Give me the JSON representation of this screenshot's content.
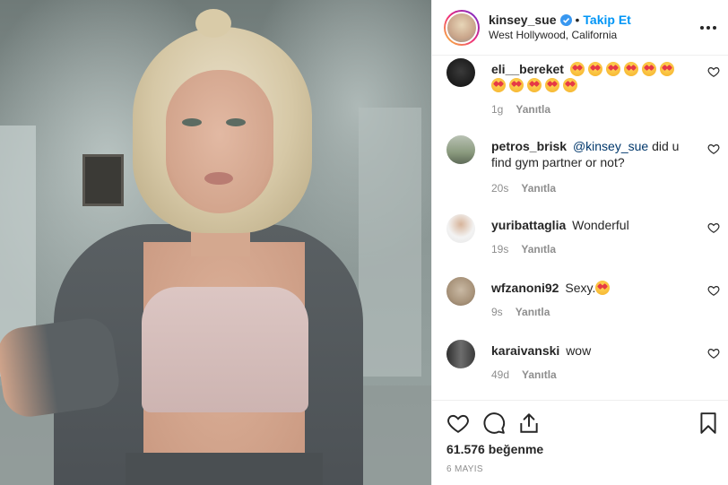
{
  "post": {
    "username": "kinsey_sue",
    "separator": "•",
    "follow_label": "Takip Et",
    "location": "West Hollywood, California"
  },
  "comments": [
    {
      "user": "eli__bereket",
      "text": "",
      "emoji_count": 11,
      "time": "1g",
      "reply_label": "Yanıtla"
    },
    {
      "user": "petros_brisk",
      "mention": "@kinsey_sue",
      "text": "did u find gym partner or not?",
      "time": "20s",
      "reply_label": "Yanıtla"
    },
    {
      "user": "yuribattaglia",
      "text": "Wonderful",
      "time": "19s",
      "reply_label": "Yanıtla"
    },
    {
      "user": "wfzanoni92",
      "text": "Sexy.",
      "emoji_count": 1,
      "time": "9s",
      "reply_label": "Yanıtla"
    },
    {
      "user": "karaivanski",
      "text": "wow",
      "time": "49d",
      "reply_label": "Yanıtla"
    }
  ],
  "actions": {
    "likes": "61.576 beğenme",
    "date": "6 MAYIS",
    "icons": [
      "heart-icon",
      "comment-icon",
      "share-icon",
      "bookmark-icon"
    ]
  },
  "colors": {
    "accent": "#0095f6",
    "text": "#262626",
    "muted": "#8e8e8e",
    "border": "#efefef"
  }
}
